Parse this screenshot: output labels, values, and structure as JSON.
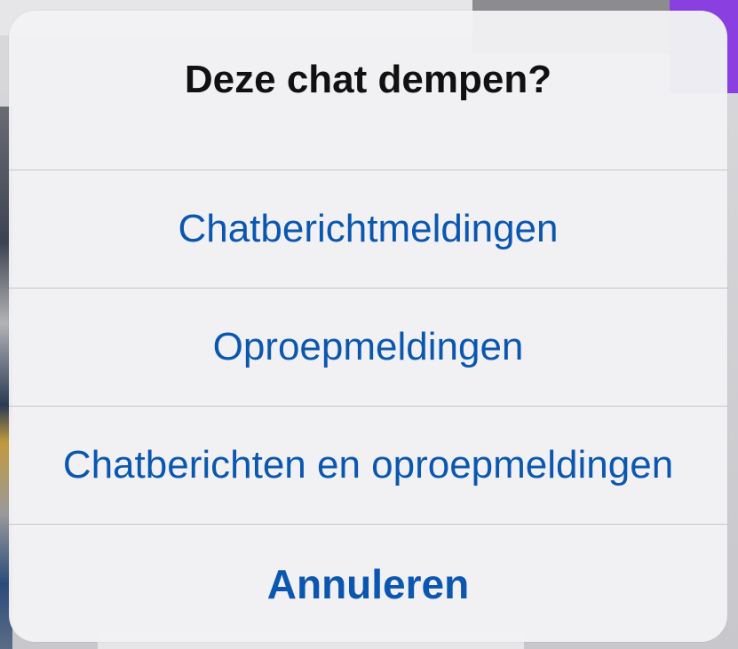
{
  "sheet": {
    "title": "Deze chat dempen?",
    "options": [
      {
        "label": "Chatberichtmeldingen"
      },
      {
        "label": "Oproepmeldingen"
      },
      {
        "label": "Chatberichten en oproepmeldingen"
      }
    ],
    "cancel_label": "Annuleren"
  },
  "colors": {
    "action_text": "#0b57b0",
    "title_text": "#111111",
    "sheet_background": "#f2f2f4",
    "separator": "#c7c7cc",
    "background_accent": "#8a3fe0"
  }
}
